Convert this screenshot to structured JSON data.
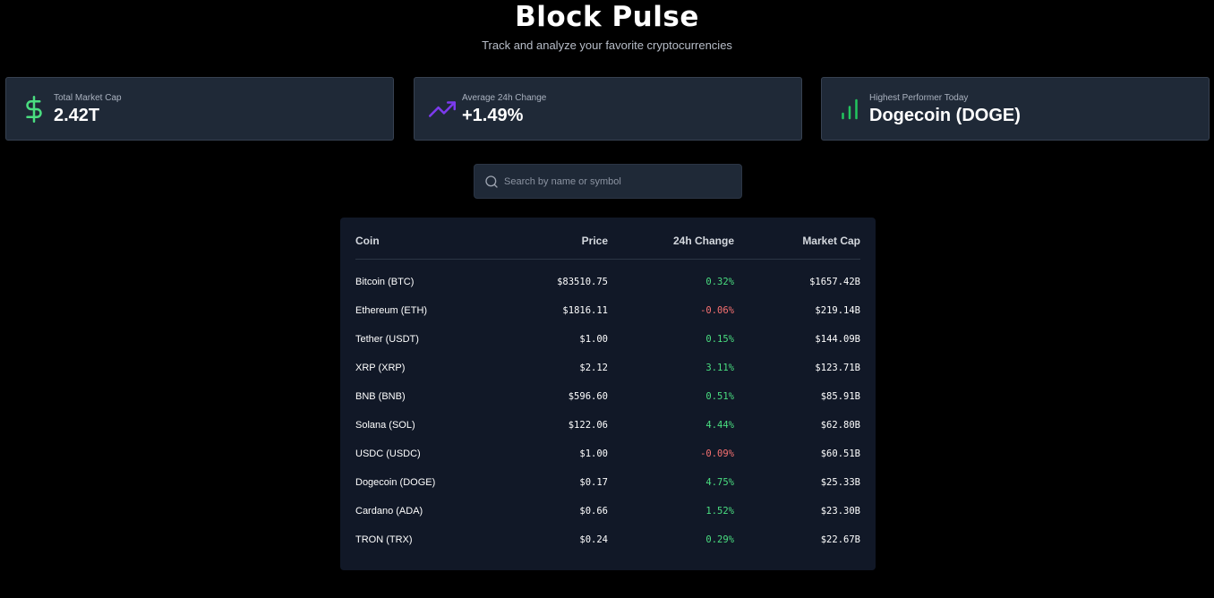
{
  "header": {
    "title": "Block Pulse",
    "subtitle": "Track and analyze your favorite cryptocurrencies"
  },
  "stats": [
    {
      "label": "Total Market Cap",
      "value": "2.42T",
      "icon": "dollar-icon",
      "color": "#4ade80"
    },
    {
      "label": "Average 24h Change",
      "value": "+1.49%",
      "icon": "trending-up-icon",
      "color": "#7c3aed"
    },
    {
      "label": "Highest Performer Today",
      "value": "Dogecoin (DOGE)",
      "icon": "bar-chart-icon",
      "color": "#22c55e"
    }
  ],
  "search": {
    "placeholder": "Search by name or symbol",
    "value": ""
  },
  "table": {
    "headers": {
      "coin": "Coin",
      "price": "Price",
      "change": "24h Change",
      "cap": "Market Cap"
    },
    "rows": [
      {
        "coin": "Bitcoin (BTC)",
        "price": "$83510.75",
        "change": "0.32%",
        "cap": "$1657.42B",
        "dir": "pos"
      },
      {
        "coin": "Ethereum (ETH)",
        "price": "$1816.11",
        "change": "-0.06%",
        "cap": "$219.14B",
        "dir": "neg"
      },
      {
        "coin": "Tether (USDT)",
        "price": "$1.00",
        "change": "0.15%",
        "cap": "$144.09B",
        "dir": "pos"
      },
      {
        "coin": "XRP (XRP)",
        "price": "$2.12",
        "change": "3.11%",
        "cap": "$123.71B",
        "dir": "pos"
      },
      {
        "coin": "BNB (BNB)",
        "price": "$596.60",
        "change": "0.51%",
        "cap": "$85.91B",
        "dir": "pos"
      },
      {
        "coin": "Solana (SOL)",
        "price": "$122.06",
        "change": "4.44%",
        "cap": "$62.80B",
        "dir": "pos"
      },
      {
        "coin": "USDC (USDC)",
        "price": "$1.00",
        "change": "-0.09%",
        "cap": "$60.51B",
        "dir": "neg"
      },
      {
        "coin": "Dogecoin (DOGE)",
        "price": "$0.17",
        "change": "4.75%",
        "cap": "$25.33B",
        "dir": "pos"
      },
      {
        "coin": "Cardano (ADA)",
        "price": "$0.66",
        "change": "1.52%",
        "cap": "$23.30B",
        "dir": "pos"
      },
      {
        "coin": "TRON (TRX)",
        "price": "$0.24",
        "change": "0.29%",
        "cap": "$22.67B",
        "dir": "pos"
      }
    ]
  },
  "colors": {
    "positive": "#4ade80",
    "negative": "#f87171",
    "card_bg": "#1f2937",
    "table_bg": "#111827"
  }
}
